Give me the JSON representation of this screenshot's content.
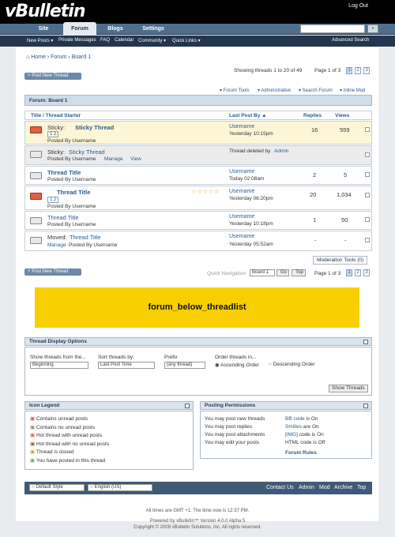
{
  "header": {
    "logo": "vBulletin",
    "logout": "Log Out"
  },
  "nav": {
    "tabs": [
      "Site",
      "Forum",
      "Blogs",
      "Settings"
    ]
  },
  "subnav": {
    "items": [
      "New Posts ▾",
      "Private Messages",
      "FAQ",
      "Calendar",
      "Community ▾",
      "Quick Links ▾"
    ],
    "advanced": "Advanced Search"
  },
  "breadcrumb": [
    "Home",
    "Forum",
    "Board 1"
  ],
  "post_new": "Post New Thread",
  "showing": "Showing threads 1 to 20 of 49",
  "pagination": {
    "label": "Page 1 of 3",
    "pages": [
      "1",
      "2",
      "3"
    ]
  },
  "tools": [
    "▾ Forum Tools",
    "▾ Administrative",
    "▾ Search Forum",
    "▾ Inline Mod"
  ],
  "forum_title": "Forum: Board 1",
  "columns": {
    "title": "Title / Thread Starter",
    "lastpost": "Last Post By ▲",
    "replies": "Replies",
    "views": "Views"
  },
  "threads": [
    {
      "prefix": "Sticky:",
      "title": "Sticky Thread",
      "pages": "1 2",
      "starter": "Posted By Username",
      "user": "Username",
      "time": "Yesterday 10:15pm",
      "replies": "16",
      "views": "559"
    },
    {
      "prefix": "Sticky:",
      "title": "Sticky Thread",
      "starter": "Posted By Username",
      "manage": "Manage",
      "view": "View",
      "deleted": "Thread deleted by",
      "admin": "Admin"
    },
    {
      "title": "Thread Title",
      "starter": "Posted By Username",
      "user": "Username",
      "time": "Today 02:08am",
      "replies": "2",
      "views": "5"
    },
    {
      "title": "Thread Title",
      "pages": "1 2",
      "starter": "Posted By Username",
      "user": "Username",
      "time": "Yesterday 06:20pm",
      "replies": "20",
      "views": "1,034"
    },
    {
      "title": "Thread Title",
      "starter": "Posted By Username",
      "user": "Username",
      "time": "Yesterday 10:18pm",
      "replies": "1",
      "views": "50"
    },
    {
      "prefix": "Moved:",
      "title": "Thread Title",
      "manage": "Manage",
      "starter": "Posted By Username",
      "user": "Username",
      "time": "Yesterday 05:52am",
      "replies": "-",
      "views": "-"
    }
  ],
  "modtools": "Moderation Tools (0)",
  "quicknav": {
    "label": "Quick Navigation",
    "value": "Board 1",
    "go": "Go",
    "top": "Top"
  },
  "banner": "forum_below_threadlist",
  "display_options": {
    "title": "Thread Display Options",
    "show_from": "Show threads from the...",
    "show_from_val": "Beginning",
    "sort_by": "Sort threads by:",
    "sort_val": "Last Post Time",
    "prefix": "Prefix",
    "prefix_val": "(any thread)",
    "order": "Order threads in...",
    "asc": "Ascending Order",
    "desc": "Descending Order",
    "button": "Show Threads"
  },
  "legend": {
    "title": "Icon Legend",
    "items": [
      "Contains unread posts",
      "Contains no unread posts",
      "Hot thread with unread posts",
      "Hot thread with no unread posts",
      "Thread is closed",
      "You have posted in this thread"
    ]
  },
  "permissions": {
    "title": "Posting Permissions",
    "rules": [
      "You may post new threads",
      "You may post replies",
      "You may post attachments",
      "You may edit your posts"
    ],
    "codes": [
      {
        "a": "BB code",
        "b": " is On"
      },
      {
        "a": "Smilies",
        "b": " are On"
      },
      {
        "a": "[IMG]",
        "b": " code is On"
      },
      {
        "a": "",
        "b": "HTML code is Off"
      }
    ],
    "forum_rules": "Forum Rules"
  },
  "footer": {
    "style": "-- Default Style",
    "lang": "-- English (US)",
    "links": [
      "Contact Us",
      "Admin",
      "Mod",
      "Archive",
      "Top"
    ],
    "time": "All times are GMT +1. The time now is 12:37 PM.",
    "powered": "Powered by vBulletin™ Version 4.0.0 Alpha 5",
    "copyright": "Copyright © 2009 vBulletin Solutions, Inc. All rights reserved."
  }
}
